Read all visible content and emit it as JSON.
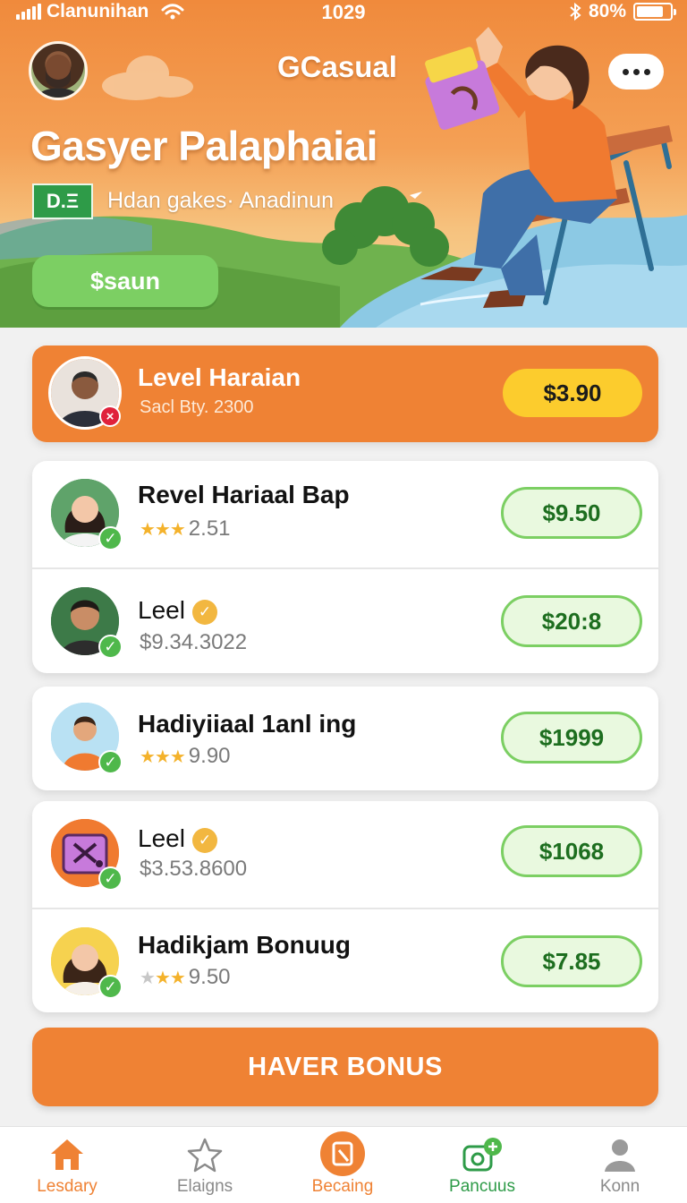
{
  "status_bar": {
    "carrier": "Clanunihan",
    "time": "1029",
    "battery": "80%",
    "battery_level": 0.8
  },
  "header": {
    "app_title": "GCasual",
    "heading": "Gasyer Palaphaiai",
    "badge": "D.Ξ",
    "subtitle": "Hdan gakes· Anadinun",
    "cta_label": "$saun"
  },
  "featured": {
    "title": "Level Haraian",
    "subtitle": "Sacl Bty. 2300",
    "price": "$3.90"
  },
  "rows": [
    {
      "title": "Revel Hariaal Bap",
      "stars": 3,
      "rating": "2.51",
      "price": "$9.50"
    },
    {
      "title": "Leel",
      "detail": "$9.34.3022",
      "price": "$20:8"
    },
    {
      "title": "Hadiyiiaal 1anl ing",
      "stars": 3,
      "rating": "9.90",
      "price": "$1999"
    },
    {
      "title": "Leel",
      "detail": "$3.53.8600",
      "price": "$1068"
    },
    {
      "title": "Hadikjam Bonuug",
      "stars": 2,
      "rating": "9.50",
      "price": "$7.85"
    }
  ],
  "bonus_button": "HAVER BONUS",
  "nav": [
    {
      "label": "Lesdary",
      "icon": "home-icon",
      "color": "#ef8234"
    },
    {
      "label": "Elaigns",
      "icon": "star-icon",
      "color": "#8a8a8a"
    },
    {
      "label": "Becaing",
      "icon": "shop-icon",
      "color": "#ef8234"
    },
    {
      "label": "Pancuus",
      "icon": "camera-plus-icon",
      "color": "#2e9b48"
    },
    {
      "label": "Konn",
      "icon": "person-icon",
      "color": "#8a8a8a"
    }
  ],
  "colors": {
    "primary": "#ef8234",
    "accent_green": "#7ccf63",
    "price_yellow": "#fccc2d"
  }
}
